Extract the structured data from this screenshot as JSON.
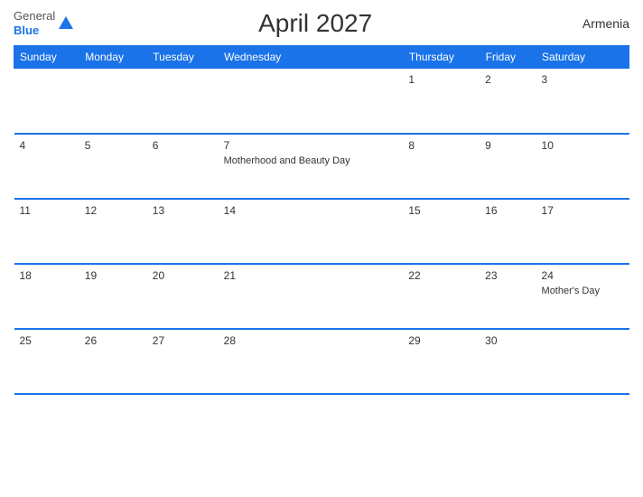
{
  "header": {
    "logo_general": "General",
    "logo_blue": "Blue",
    "title": "April 2027",
    "country": "Armenia"
  },
  "weekdays": [
    "Sunday",
    "Monday",
    "Tuesday",
    "Wednesday",
    "Thursday",
    "Friday",
    "Saturday"
  ],
  "weeks": [
    {
      "days": [
        {
          "num": "",
          "event": ""
        },
        {
          "num": "",
          "event": ""
        },
        {
          "num": "",
          "event": ""
        },
        {
          "num": "",
          "event": ""
        },
        {
          "num": "1",
          "event": ""
        },
        {
          "num": "2",
          "event": ""
        },
        {
          "num": "3",
          "event": ""
        }
      ]
    },
    {
      "days": [
        {
          "num": "4",
          "event": ""
        },
        {
          "num": "5",
          "event": ""
        },
        {
          "num": "6",
          "event": ""
        },
        {
          "num": "7",
          "event": "Motherhood and Beauty Day"
        },
        {
          "num": "8",
          "event": ""
        },
        {
          "num": "9",
          "event": ""
        },
        {
          "num": "10",
          "event": ""
        }
      ]
    },
    {
      "days": [
        {
          "num": "11",
          "event": ""
        },
        {
          "num": "12",
          "event": ""
        },
        {
          "num": "13",
          "event": ""
        },
        {
          "num": "14",
          "event": ""
        },
        {
          "num": "15",
          "event": ""
        },
        {
          "num": "16",
          "event": ""
        },
        {
          "num": "17",
          "event": ""
        }
      ]
    },
    {
      "days": [
        {
          "num": "18",
          "event": ""
        },
        {
          "num": "19",
          "event": ""
        },
        {
          "num": "20",
          "event": ""
        },
        {
          "num": "21",
          "event": ""
        },
        {
          "num": "22",
          "event": ""
        },
        {
          "num": "23",
          "event": ""
        },
        {
          "num": "24",
          "event": "Mother's Day"
        }
      ]
    },
    {
      "days": [
        {
          "num": "25",
          "event": ""
        },
        {
          "num": "26",
          "event": ""
        },
        {
          "num": "27",
          "event": ""
        },
        {
          "num": "28",
          "event": ""
        },
        {
          "num": "29",
          "event": ""
        },
        {
          "num": "30",
          "event": ""
        },
        {
          "num": "",
          "event": ""
        }
      ]
    }
  ]
}
